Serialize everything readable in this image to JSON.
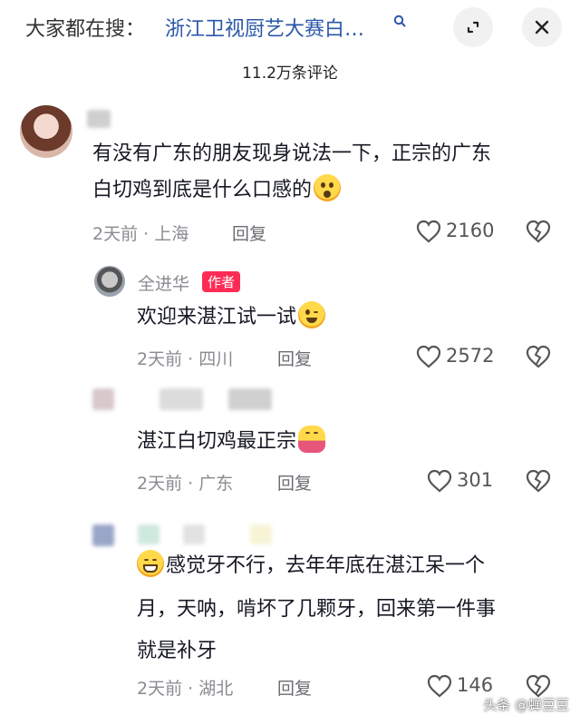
{
  "header": {
    "search_prefix": "大家都在搜：",
    "search_query": "浙江卫视厨艺大赛白…"
  },
  "comment_count": "11.2万条评论",
  "comments": [
    {
      "lines": [
        "有没有广东的朋友现身说法一下，正宗的广东",
        "白切鸡到底是什么口感的"
      ],
      "time": "2天前",
      "location": "上海",
      "reply": "回复",
      "likes": "2160"
    },
    {
      "author": "全进华",
      "tag": "作者",
      "text": "欢迎来湛江试一试",
      "time": "2天前",
      "location": "四川",
      "reply": "回复",
      "likes": "2572"
    },
    {
      "text": "湛江白切鸡最正宗",
      "time": "2天前",
      "location": "广东",
      "reply": "回复",
      "likes": "301"
    },
    {
      "lines": [
        "感觉牙不行，去年年底在湛江呆一个",
        "月，天呐，啃坏了几颗牙，回来第一件事",
        "就是补牙"
      ],
      "time": "2天前",
      "location": "湖北",
      "reply": "回复",
      "likes": "146"
    }
  ],
  "separator": "·",
  "watermark": "头条 @蝉豆豆"
}
